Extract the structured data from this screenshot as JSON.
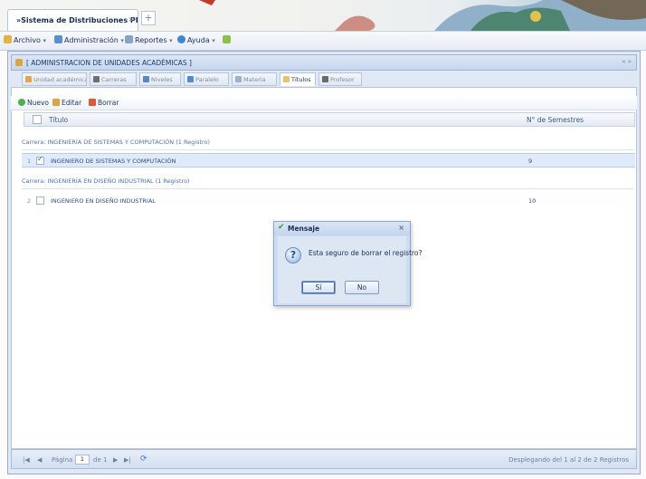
{
  "browser": {
    "tab_title": "»Sistema de Distribuciones PRICESA»",
    "tab_close": "×",
    "new_tab": "+"
  },
  "menubar": {
    "items": [
      {
        "label": "Archivo",
        "icon": "archive-icon"
      },
      {
        "label": "Administración",
        "icon": "admin-icon"
      },
      {
        "label": "Reportes",
        "icon": "reports-icon"
      },
      {
        "label": "Ayuda",
        "icon": "help-icon"
      }
    ],
    "caret": "▾"
  },
  "panel": {
    "title": "[ ADMINISTRACION DE UNIDADES ACADÉMICAS ]",
    "pin": "« »",
    "subtabs": [
      {
        "label": "Unidad académica",
        "icon": "unit-icon",
        "active": false
      },
      {
        "label": "Carreras",
        "icon": "careers-icon",
        "active": false
      },
      {
        "label": "Niveles",
        "icon": "levels-icon",
        "active": false
      },
      {
        "label": "Paralelo",
        "icon": "parallel-icon",
        "active": false
      },
      {
        "label": "Materia",
        "icon": "subject-icon",
        "active": false
      },
      {
        "label": "Títulos",
        "icon": "titles-icon",
        "active": true
      },
      {
        "label": "Profesor",
        "icon": "teacher-icon",
        "active": false
      }
    ]
  },
  "toolbar": {
    "new_label": "Nuevo",
    "edit_label": "Editar",
    "delete_label": "Borrar"
  },
  "grid": {
    "col_title": "Título",
    "col_semesters": "N° de Semestres",
    "groups": [
      {
        "title": "Carrera: INGENIERÍA DE SISTEMAS Y COMPUTACIÓN (1 Registro)",
        "rows": [
          {
            "num": "1",
            "title": "INGENIERO DE SISTEMAS Y COMPUTACIÓN",
            "semesters": "9",
            "selected": true
          }
        ]
      },
      {
        "title": "Carrera: INGENIERÍA EN DISEÑO INDUSTRIAL (1 Registro)",
        "rows": [
          {
            "num": "2",
            "title": "INGENIERO EN DISEÑO INDUSTRIAL",
            "semesters": "10",
            "selected": false
          }
        ]
      }
    ]
  },
  "paging": {
    "first": "|◀",
    "prev": "◀",
    "page_label": "Página",
    "page_value": "1",
    "of_label": "de 1",
    "next": "▶",
    "last": "▶|",
    "refresh": "⟳",
    "summary": "Desplegando del 1 al 2 de 2 Registros"
  },
  "dialog": {
    "title": "Mensaje",
    "close": "×",
    "icon": "question-icon",
    "icon_glyph": "?",
    "message": "Esta seguro de borrar el registro?",
    "yes_label": "Sí",
    "no_label": "No"
  },
  "colors": {
    "accent": "#1d3a70",
    "selected_row": "#dfeafb",
    "group_title": "#4b73ad"
  }
}
